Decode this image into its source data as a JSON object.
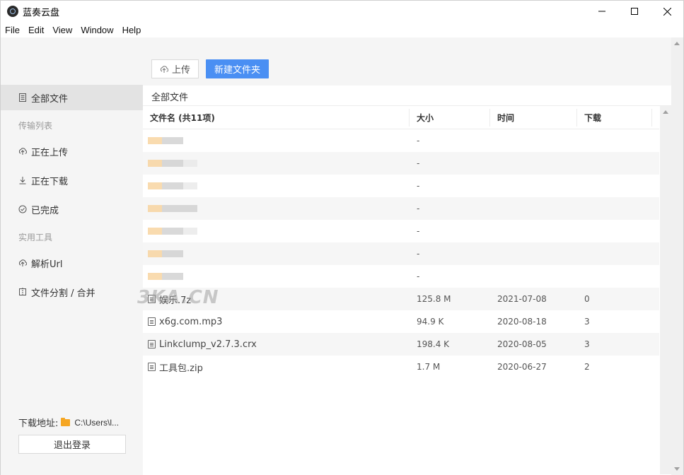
{
  "window": {
    "title": "蓝奏云盘",
    "menu": [
      "File",
      "Edit",
      "View",
      "Window",
      "Help"
    ]
  },
  "sidebar": {
    "all_files": "全部文件",
    "transfer_group": "传输列表",
    "uploading": "正在上传",
    "downloading": "正在下载",
    "completed": "已完成",
    "tools_group": "实用工具",
    "parse_url": "解析Url",
    "split_merge": "文件分割 / 合并",
    "download_path_label": "下载地址:",
    "download_path_value": "C:\\Users\\l...",
    "logout": "退出登录"
  },
  "toolbar": {
    "upload": "上传",
    "new_folder": "新建文件夹"
  },
  "breadcrumb": "全部文件",
  "table": {
    "headers": {
      "name": "文件名 (共11项)",
      "size": "大小",
      "time": "时间",
      "downloads": "下载"
    },
    "folders": [
      {
        "size": "-"
      },
      {
        "size": "-"
      },
      {
        "size": "-"
      },
      {
        "size": "-"
      },
      {
        "size": "-"
      },
      {
        "size": "-"
      },
      {
        "size": "-"
      }
    ],
    "files": [
      {
        "name": "娱乐.7z",
        "size": "125.8 M",
        "time": "2021-07-08",
        "downloads": "0"
      },
      {
        "name": "x6g.com.mp3",
        "size": "94.9 K",
        "time": "2020-08-18",
        "downloads": "3"
      },
      {
        "name": "Linkclump_v2.7.3.crx",
        "size": "198.4 K",
        "time": "2020-08-05",
        "downloads": "3"
      },
      {
        "name": "工具包.zip",
        "size": "1.7 M",
        "time": "2020-06-27",
        "downloads": "2"
      }
    ]
  },
  "watermark": "3KA.CN"
}
